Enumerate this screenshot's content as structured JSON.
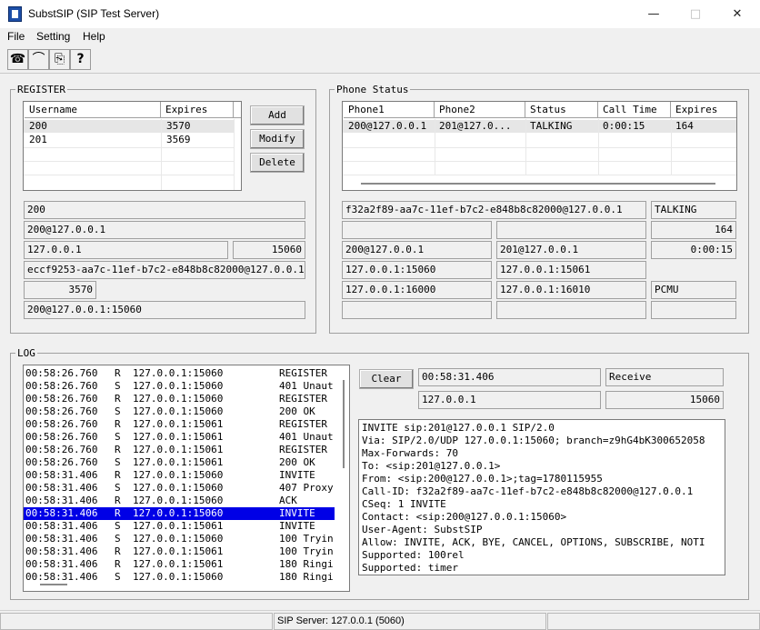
{
  "window": {
    "title": "SubstSIP (SIP Test Server)",
    "minimize_icon": "—",
    "maximize_icon": "□",
    "close_icon": "✕"
  },
  "menu": {
    "file": "File",
    "setting": "Setting",
    "help": "Help"
  },
  "toolbar": {
    "call_icon": "☎",
    "hangup_icon": "⌒",
    "export_icon": "⎘",
    "help_icon": "?"
  },
  "register": {
    "label": "REGISTER",
    "columns": [
      "Username",
      "Expires"
    ],
    "rows": [
      [
        "200",
        "3570"
      ],
      [
        "201",
        "3569"
      ]
    ],
    "add": "Add",
    "modify": "Modify",
    "delete": "Delete",
    "fields": {
      "username": "200",
      "uri": "200@127.0.0.1",
      "ip": "127.0.0.1",
      "port": "15060",
      "call_id": "eccf9253-aa7c-11ef-b7c2-e848b8c82000@127.0.0.1",
      "expires": "3570",
      "contact": "200@127.0.0.1:15060"
    }
  },
  "phone_status": {
    "label": "Phone Status",
    "columns": [
      "Phone1",
      "Phone2",
      "Status",
      "Call Time",
      "Expires"
    ],
    "rows": [
      [
        "200@127.0.0.1",
        "201@127.0...",
        "TALKING",
        "0:00:15",
        "164"
      ]
    ],
    "fields": {
      "call_id": "f32a2f89-aa7c-11ef-b7c2-e848b8c82000@127.0.0.1",
      "status": "TALKING",
      "blank1": "",
      "blank2": "",
      "expires": "164",
      "phone1": "200@127.0.0.1",
      "phone2": "201@127.0.0.1",
      "call_time": "0:00:15",
      "phone1_addr": "127.0.0.1:15060",
      "phone2_addr": "127.0.0.1:15061",
      "phone1_rtp": "127.0.0.1:16000",
      "phone2_rtp": "127.0.0.1:16010",
      "codec": "PCMU",
      "blank3": "",
      "blank4": "",
      "blank5": ""
    }
  },
  "log": {
    "label": "LOG",
    "clear": "Clear",
    "time": "00:58:31.406",
    "direction": "Receive",
    "ip": "127.0.0.1",
    "port": "15060",
    "entries": [
      [
        "00:58:26.760",
        "R",
        "127.0.0.1:15060",
        "REGISTER"
      ],
      [
        "00:58:26.760",
        "S",
        "127.0.0.1:15060",
        "401 Unaut"
      ],
      [
        "00:58:26.760",
        "R",
        "127.0.0.1:15060",
        "REGISTER"
      ],
      [
        "00:58:26.760",
        "S",
        "127.0.0.1:15060",
        "200 OK"
      ],
      [
        "00:58:26.760",
        "R",
        "127.0.0.1:15061",
        "REGISTER"
      ],
      [
        "00:58:26.760",
        "S",
        "127.0.0.1:15061",
        "401 Unaut"
      ],
      [
        "00:58:26.760",
        "R",
        "127.0.0.1:15061",
        "REGISTER"
      ],
      [
        "00:58:26.760",
        "S",
        "127.0.0.1:15061",
        "200 OK"
      ],
      [
        "00:58:31.406",
        "R",
        "127.0.0.1:15060",
        "INVITE"
      ],
      [
        "00:58:31.406",
        "S",
        "127.0.0.1:15060",
        "407 Proxy"
      ],
      [
        "00:58:31.406",
        "R",
        "127.0.0.1:15060",
        "ACK"
      ],
      [
        "00:58:31.406",
        "R",
        "127.0.0.1:15060",
        "INVITE"
      ],
      [
        "00:58:31.406",
        "S",
        "127.0.0.1:15061",
        "INVITE"
      ],
      [
        "00:58:31.406",
        "S",
        "127.0.0.1:15060",
        "100 Tryin"
      ],
      [
        "00:58:31.406",
        "R",
        "127.0.0.1:15061",
        "100 Tryin"
      ],
      [
        "00:58:31.406",
        "R",
        "127.0.0.1:15061",
        "180 Ringi"
      ],
      [
        "00:58:31.406",
        "S",
        "127.0.0.1:15060",
        "180 Ringi"
      ]
    ],
    "selected_index": 11,
    "message": [
      "INVITE sip:201@127.0.0.1 SIP/2.0",
      "Via: SIP/2.0/UDP 127.0.0.1:15060; branch=z9hG4bK300652058",
      "Max-Forwards: 70",
      "To: <sip:201@127.0.0.1>",
      "From: <sip:200@127.0.0.1>;tag=1780115955",
      "Call-ID: f32a2f89-aa7c-11ef-b7c2-e848b8c82000@127.0.0.1",
      "CSeq: 1 INVITE",
      "Contact: <sip:200@127.0.0.1:15060>",
      "User-Agent: SubstSIP",
      "Allow: INVITE, ACK, BYE, CANCEL, OPTIONS, SUBSCRIBE, NOTI",
      "Supported: 100rel",
      "Supported: timer"
    ]
  },
  "status_bar": {
    "server": "SIP Server: 127.0.0.1 (5060)"
  }
}
